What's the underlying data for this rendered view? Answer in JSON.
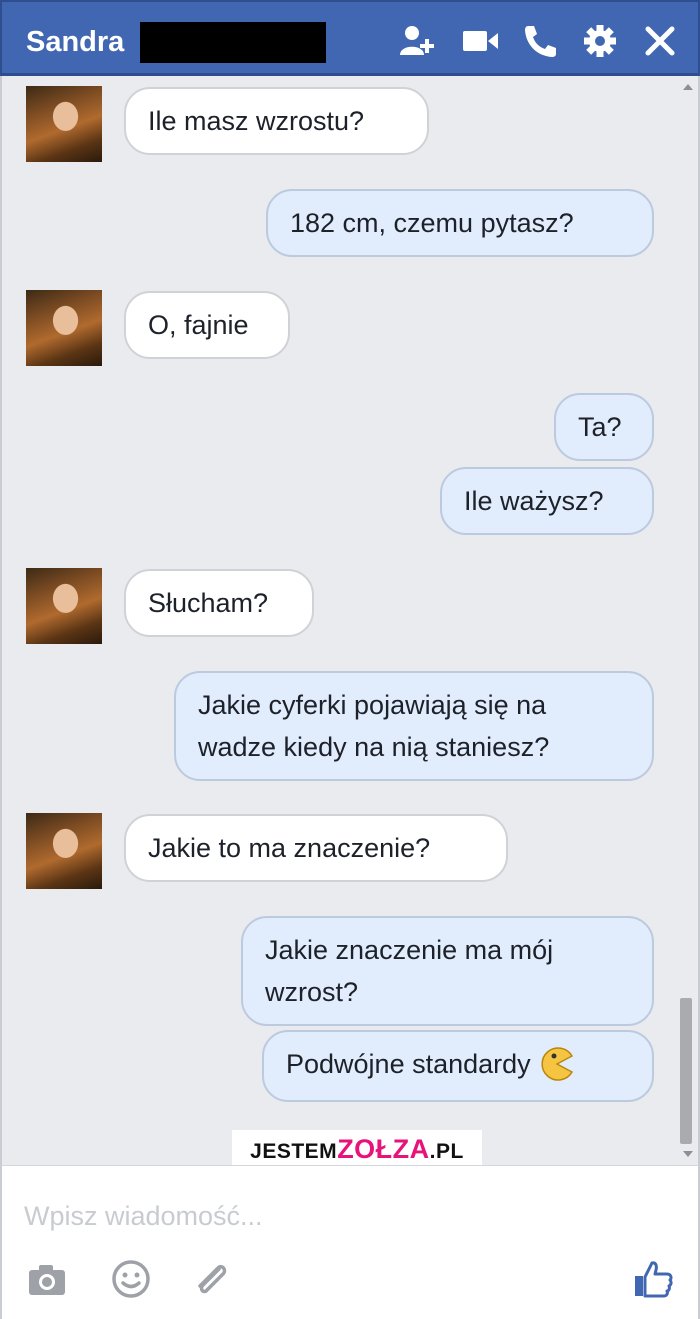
{
  "header": {
    "contact_name": "Sandra",
    "icons": [
      "add-friend-icon",
      "video-call-icon",
      "phone-icon",
      "gear-icon",
      "close-icon"
    ]
  },
  "messages": [
    {
      "side": "in",
      "text": "Ile masz wzrostu?"
    },
    {
      "side": "out",
      "text": "182 cm, czemu pytasz?"
    },
    {
      "side": "in",
      "text": "O, fajnie"
    },
    {
      "side": "out",
      "text": "Ta?"
    },
    {
      "side": "out",
      "text": "Ile ważysz?"
    },
    {
      "side": "in",
      "text": "Słucham?"
    },
    {
      "side": "out",
      "text": "Jakie cyferki pojawiają się na wadze kiedy na nią staniesz?"
    },
    {
      "side": "in",
      "text": "Jakie to ma znaczenie?"
    },
    {
      "side": "out",
      "text": "Jakie znaczenie ma mój wzrost?"
    },
    {
      "side": "out",
      "text": "Podwójne standardy",
      "emoji": "pacman-emoji"
    }
  ],
  "watermark": {
    "part1": "JESTEM",
    "part2": "ZOŁZA",
    "part3": ".PL"
  },
  "composer": {
    "placeholder": "Wpisz wiadomość...",
    "icons": [
      "camera-icon",
      "smiley-icon",
      "paperclip-icon",
      "thumbs-up-icon"
    ]
  },
  "colors": {
    "header": "#4267b2",
    "outgoing_bubble": "#e1ecfc",
    "incoming_bubble": "#ffffff",
    "accent": "#4267b2"
  }
}
